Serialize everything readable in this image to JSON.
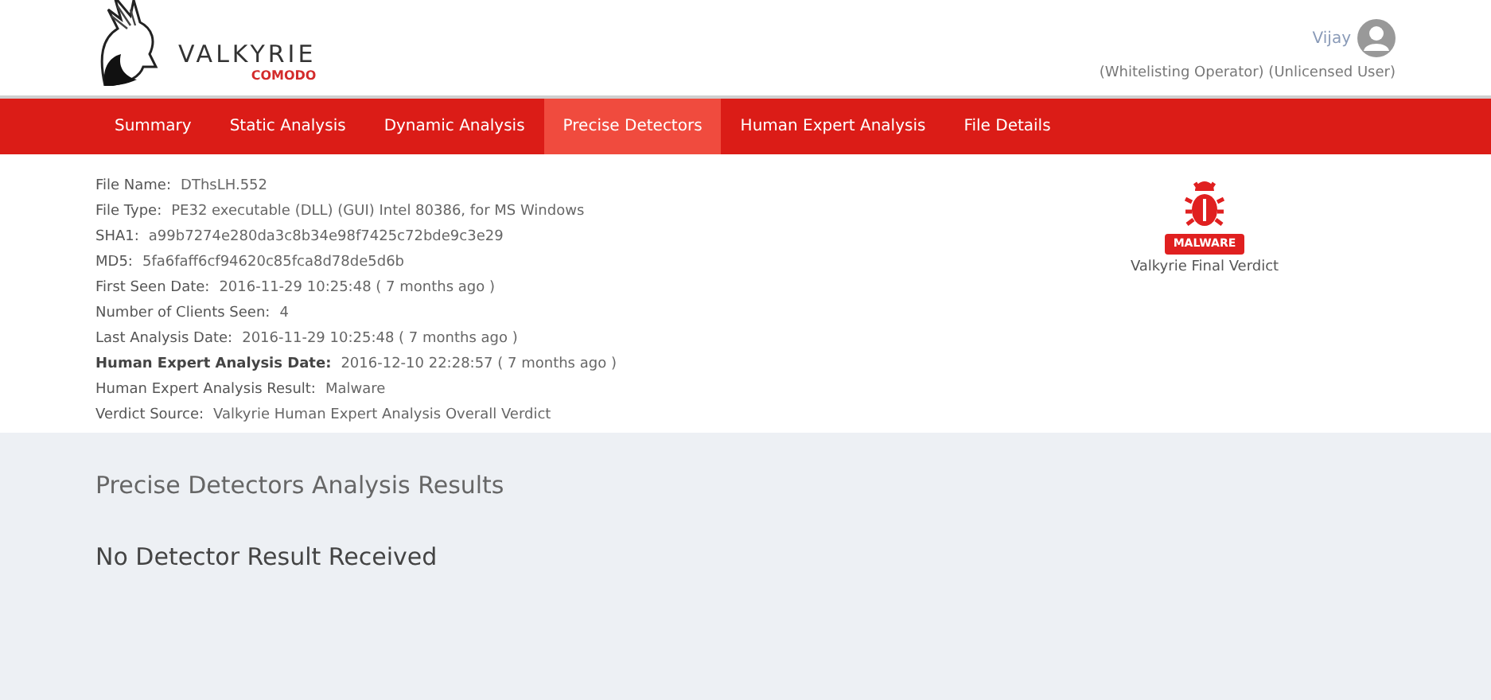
{
  "logo": {
    "name": "VALKYRIE",
    "sub": "COMODO"
  },
  "user": {
    "name": "Vijay",
    "roles": "(Whitelisting Operator) (Unlicensed User)"
  },
  "tabs": [
    {
      "label": "Summary",
      "selected": false
    },
    {
      "label": "Static Analysis",
      "selected": false
    },
    {
      "label": "Dynamic Analysis",
      "selected": false
    },
    {
      "label": "Precise Detectors",
      "selected": true
    },
    {
      "label": "Human Expert Analysis",
      "selected": false
    },
    {
      "label": "File Details",
      "selected": false
    }
  ],
  "fields": [
    {
      "label": "File Name:",
      "value": "DThsLH.552",
      "bold": false
    },
    {
      "label": "File Type:",
      "value": "PE32 executable (DLL) (GUI) Intel 80386, for MS Windows",
      "bold": false
    },
    {
      "label": "SHA1:",
      "value": "a99b7274e280da3c8b34e98f7425c72bde9c3e29",
      "bold": false
    },
    {
      "label": "MD5:",
      "value": "5fa6faff6cf94620c85fca8d78de5d6b",
      "bold": false
    },
    {
      "label": "First Seen Date:",
      "value": "2016-11-29 10:25:48 ( 7 months ago )",
      "bold": false
    },
    {
      "label": "Number of Clients Seen:",
      "value": "4",
      "bold": false
    },
    {
      "label": "Last Analysis Date:",
      "value": "2016-11-29 10:25:48 ( 7 months ago )",
      "bold": false
    },
    {
      "label": "Human Expert Analysis Date:",
      "value": "2016-12-10 22:28:57 ( 7 months ago )",
      "bold": true
    },
    {
      "label": "Human Expert Analysis Result:",
      "value": "Malware",
      "bold": false
    },
    {
      "label": "Verdict Source:",
      "value": "Valkyrie Human Expert Analysis Overall Verdict",
      "bold": false
    }
  ],
  "verdict": {
    "badge": "MALWARE",
    "caption": "Valkyrie Final Verdict"
  },
  "results": {
    "title": "Precise Detectors Analysis Results",
    "message": "No Detector Result Received"
  }
}
